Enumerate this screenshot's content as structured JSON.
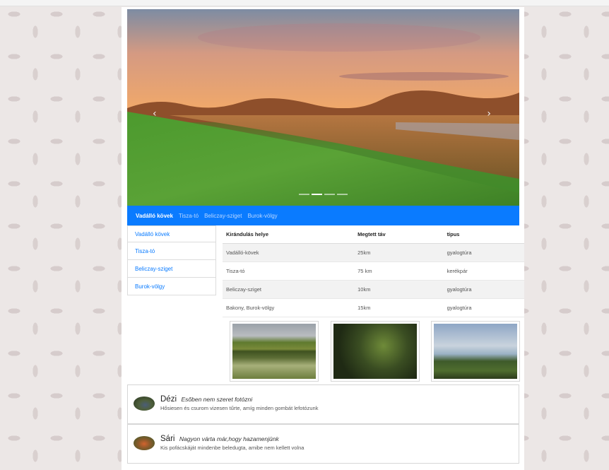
{
  "carousel": {
    "prev_icon": "chevron-left-icon",
    "next_icon": "chevron-right-icon",
    "prev_glyph": "‹",
    "next_glyph": "›",
    "slide_count": 4,
    "active_slide": 2
  },
  "navbar": {
    "items": [
      {
        "label": "Vadálló kövek",
        "active": true
      },
      {
        "label": "Tisza-tó",
        "active": false
      },
      {
        "label": "Beliczay-sziget",
        "active": false
      },
      {
        "label": "Burok-völgy",
        "active": false
      }
    ]
  },
  "sidebar": {
    "items": [
      "Vadálló kövek",
      "Tisza-tó",
      "Beliczay-sziget",
      "Burok-völgy"
    ]
  },
  "table": {
    "headers": [
      "Kirándulás helye",
      "Megtett táv",
      "típus"
    ],
    "rows": [
      [
        "Vadálló-kövek",
        "25km",
        "gyalogtúra"
      ],
      [
        "Tisza-tó",
        "75 km",
        "kerékpár"
      ],
      [
        "Beliczay-sziget",
        "10km",
        "gyalogtúra"
      ],
      [
        "Bakony, Burok-völgy",
        "15km",
        "gyalogtúra"
      ]
    ]
  },
  "comments": [
    {
      "name": "Dézi",
      "tagline": "Esőben nem szeret fotózni",
      "text": "Hősiesen és csurom vizesen tűrte, amíg minden gombát lefotózunk"
    },
    {
      "name": "Sári",
      "tagline": "Nagyon várta már,hogy hazamenjünk",
      "text": "Kis pofácskáját mindenbe beledugta, amibe nem kellett volna"
    }
  ],
  "colors": {
    "primary": "#0a7bff",
    "navbar_text": "#b8d6ff"
  }
}
